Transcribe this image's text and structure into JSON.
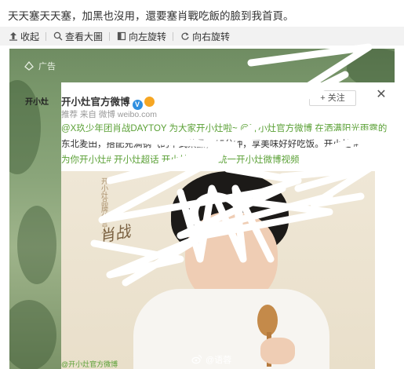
{
  "post": {
    "text": "天天塞天天塞，加黑也沒用，還要塞肖戰吃飯的臉到我首頁。"
  },
  "toolbar": {
    "items": [
      {
        "label": "收起",
        "icon": "collapse-icon"
      },
      {
        "label": "查看大圖",
        "icon": "zoom-icon"
      },
      {
        "label": "向左旋转",
        "icon": "rotate-left-icon"
      },
      {
        "label": "向右旋转",
        "icon": "rotate-right-icon"
      }
    ]
  },
  "ad": {
    "label": "广告",
    "account_name": "开小灶官方微博",
    "logo_text": "开小灶",
    "follow_label": "+ 关注",
    "meta": "推荐 来自 微博 weibo.com",
    "body_lines": [
      "@X玖少年团肖战DAYTOY 为大家开小灶啦~ @开小灶官方微博 在洒满阳光雨露的",
      "东北麦田，搭配充满锅气的中式菜品，15分钟，享美味好好吃饭。开小灶 #",
      "为你开小灶# 开小灶超话 开小灶旗舰店 统一开小灶微博视频"
    ],
    "photo_vertical_text": "开小灶品牌代言人",
    "photo_signature": "肖战",
    "photo_bottom_text": "@开小灶官方微博"
  },
  "watermark": {
    "text": "@语蓉"
  },
  "colors": {
    "toolbar_bg": "#f2f2f2",
    "link_green": "#5aa035",
    "verified_blue": "#2f8fe0",
    "scribble": "#ffffff"
  }
}
